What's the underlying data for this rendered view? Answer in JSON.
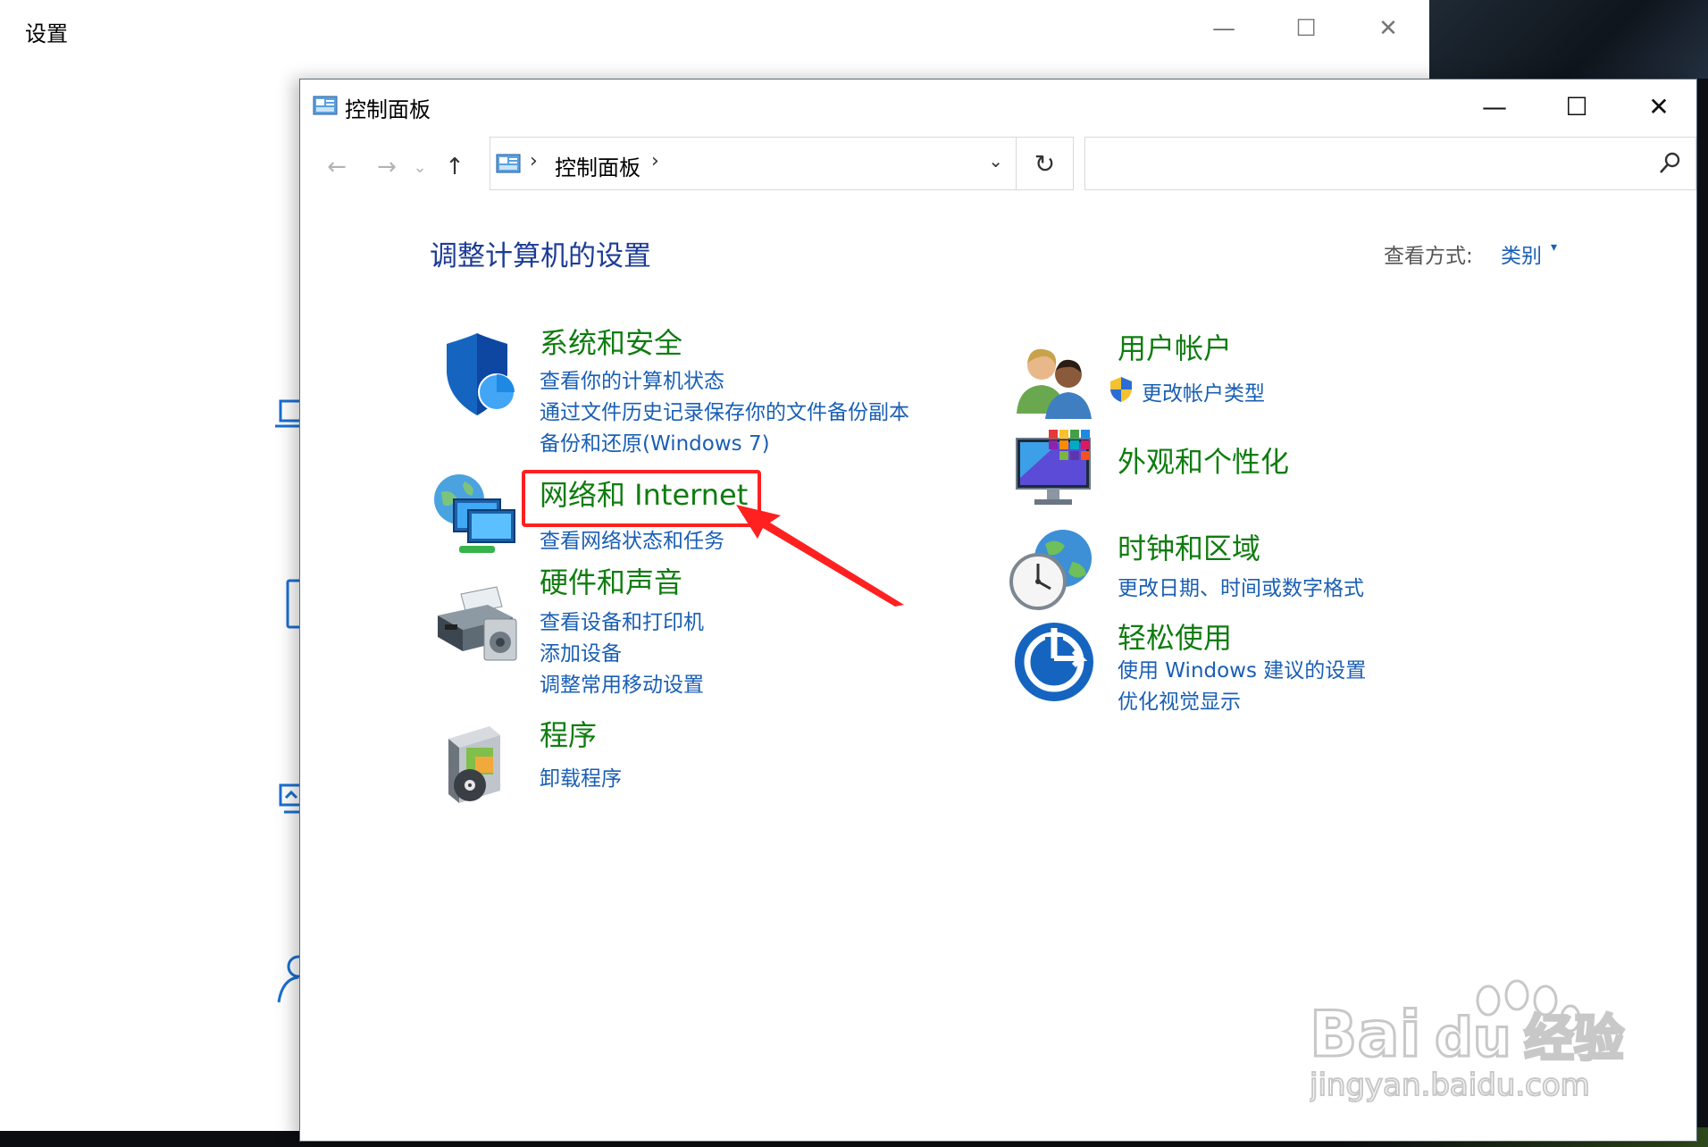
{
  "settings": {
    "title": "设置",
    "minimize_glyph": "—",
    "maximize_glyph": "☐",
    "close_glyph": "✕"
  },
  "control_panel": {
    "title": "控制面板",
    "minimize_glyph": "—",
    "maximize_glyph": "☐",
    "close_glyph": "✕",
    "nav": {
      "back_glyph": "←",
      "forward_glyph": "→",
      "recent_glyph": "⌄",
      "up_glyph": "↑"
    },
    "address": {
      "separator": "›",
      "location": "控制面板",
      "dropdown_glyph": "⌄",
      "refresh_glyph": "↻"
    },
    "search": {
      "placeholder": ""
    },
    "page_title": "调整计算机的设置",
    "view_by": {
      "label": "查看方式:",
      "value": "类别"
    },
    "categories": [
      {
        "title": "系统和安全",
        "icon": "shield-icon",
        "links": [
          "查看你的计算机状态",
          "通过文件历史记录保存你的文件备份副本",
          "备份和还原(Windows 7)"
        ]
      },
      {
        "title": "网络和 Internet",
        "icon": "network-icon",
        "links": [
          "查看网络状态和任务"
        ]
      },
      {
        "title": "硬件和声音",
        "icon": "printer-icon",
        "links": [
          "查看设备和打印机",
          "添加设备",
          "调整常用移动设置"
        ]
      },
      {
        "title": "程序",
        "icon": "programs-icon",
        "links": [
          "卸载程序"
        ]
      },
      {
        "title": "用户帐户",
        "icon": "users-icon",
        "links": [
          "更改帐户类型"
        ]
      },
      {
        "title": "外观和个性化",
        "icon": "monitor-icon",
        "links": []
      },
      {
        "title": "时钟和区域",
        "icon": "clock-globe-icon",
        "links": [
          "更改日期、时间或数字格式"
        ]
      },
      {
        "title": "轻松使用",
        "icon": "ease-of-access-icon",
        "links": [
          "使用 Windows 建议的设置",
          "优化视觉显示"
        ]
      }
    ]
  },
  "annotation": {
    "highlight_color": "#ff2020"
  },
  "watermark": {
    "brand": "Bai",
    "brand2": "du",
    "cn": "经验",
    "url": "jingyan.baidu.com"
  },
  "colors": {
    "category_title": "#107c10",
    "link": "#1a5fb4",
    "page_title": "#1e3c96"
  }
}
